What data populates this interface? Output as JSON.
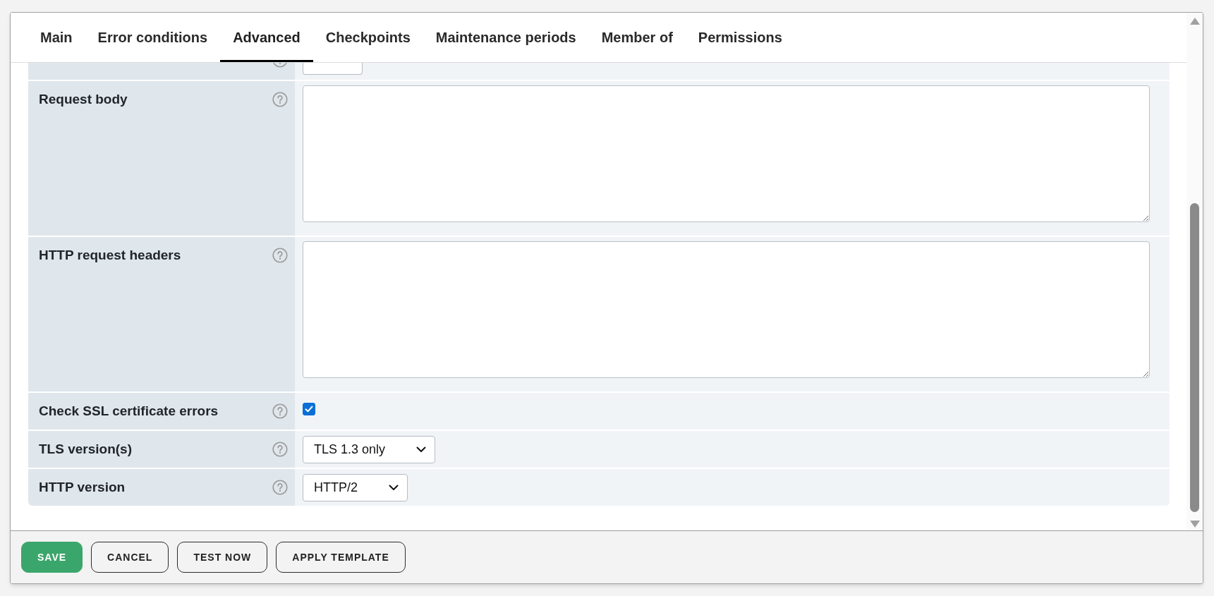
{
  "tabs": [
    {
      "label": "Main",
      "selected": false
    },
    {
      "label": "Error conditions",
      "selected": false
    },
    {
      "label": "Advanced",
      "selected": true
    },
    {
      "label": "Checkpoints",
      "selected": false
    },
    {
      "label": "Maintenance periods",
      "selected": false
    },
    {
      "label": "Member of",
      "selected": false
    },
    {
      "label": "Permissions",
      "selected": false
    }
  ],
  "form": {
    "rows": [
      {
        "kind": "textarea",
        "label": "Request body"
      },
      {
        "kind": "textarea",
        "label": "HTTP request headers"
      },
      {
        "kind": "checkbox",
        "label": "Check SSL certificate errors",
        "checked": true
      },
      {
        "kind": "select",
        "label": "TLS version(s)",
        "value": "TLS 1.3 only"
      },
      {
        "kind": "select",
        "label": "HTTP version",
        "value": "HTTP/2"
      }
    ]
  },
  "buttons": [
    {
      "kind": "primary",
      "label": "SAVE"
    },
    {
      "kind": "outline",
      "label": "CANCEL"
    },
    {
      "kind": "outline",
      "label": "TEST NOW"
    },
    {
      "kind": "outline",
      "label": "APPLY TEMPLATE"
    }
  ]
}
